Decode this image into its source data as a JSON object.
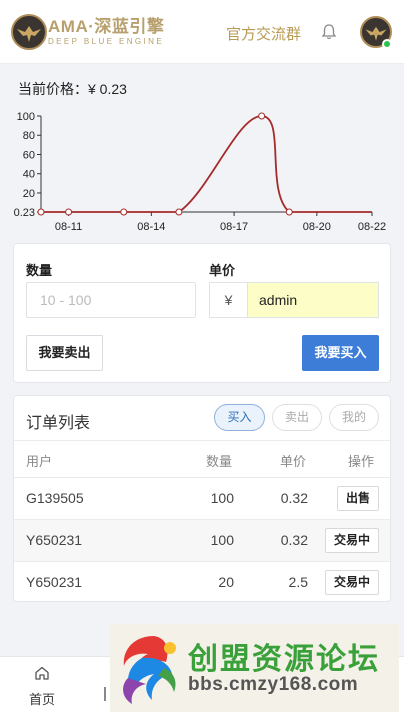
{
  "header": {
    "brand_title": "AMA·深蓝引擎",
    "brand_sub": "DEEP BLUE ENGINE",
    "group_link": "官方交流群"
  },
  "price": {
    "label": "当前价格：¥ 0.23"
  },
  "chart_data": {
    "type": "line",
    "x": [
      "08-10",
      "08-11",
      "08-13",
      "08-15",
      "08-18",
      "08-19",
      "08-22"
    ],
    "y": [
      0.23,
      0.24,
      0.23,
      0.24,
      100,
      0.23,
      0.23
    ],
    "x_ticks": [
      "08-11",
      "08-14",
      "08-17",
      "08-20",
      "08-22"
    ],
    "y_ticks": [
      "100",
      "80",
      "60",
      "40",
      "20",
      "0.23"
    ],
    "ylim": [
      0.23,
      100
    ],
    "line_color": "#a52a2a",
    "grid": false
  },
  "trade_form": {
    "qty_label": "数量",
    "price_label": "单价",
    "qty_placeholder": "10 - 100",
    "currency": "¥",
    "price_value": "admin",
    "sell_button": "我要卖出",
    "buy_button": "我要买入"
  },
  "orders": {
    "title": "订单列表",
    "filters": [
      "买入",
      "卖出",
      "我的"
    ],
    "columns": [
      "用户",
      "数量",
      "单价",
      "操作"
    ],
    "rows": [
      {
        "user": "G139505",
        "qty": "100",
        "price": "0.32",
        "action": "出售"
      },
      {
        "user": "Y650231",
        "qty": "100",
        "price": "0.32",
        "action": "交易中"
      },
      {
        "user": "Y650231",
        "qty": "20",
        "price": "2.5",
        "action": "交易中"
      }
    ]
  },
  "tabbar": {
    "home": "首页"
  },
  "watermark": {
    "title": "创盟资源论坛",
    "url": "bbs.cmzy168.com"
  },
  "colors": {
    "accent_gold": "#b89a52",
    "buy_blue": "#3d7dd8",
    "online_green": "#2ac34e",
    "chart_line": "#a52a2a"
  }
}
